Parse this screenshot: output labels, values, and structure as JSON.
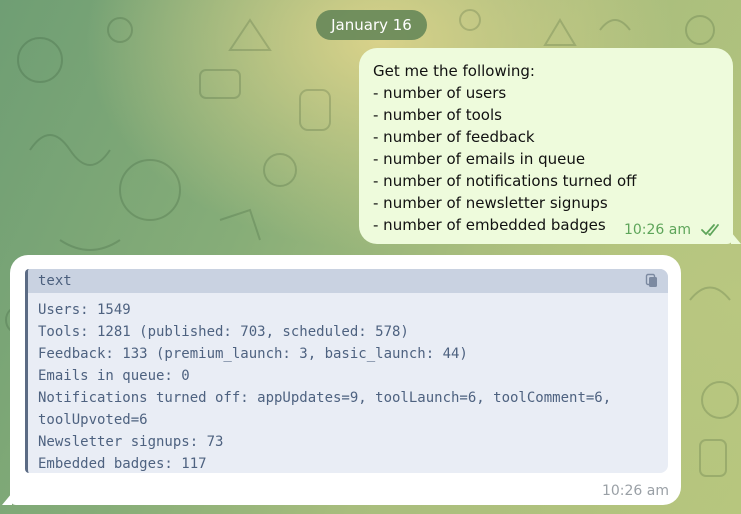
{
  "date_separator": "January 16",
  "outgoing_message": {
    "lines": [
      "Get me the following:",
      "- number of users",
      "- number of tools",
      "- number of feedback",
      "- number of emails in queue",
      "- number of notifications turned off",
      "- number of newsletter signups",
      "- number of embedded badges"
    ],
    "time": "10:26 am",
    "status_icon": "double-check-icon"
  },
  "incoming_message": {
    "code_language": "text",
    "copy_icon": "copy-icon",
    "code_lines": [
      "Users: 1549",
      "Tools: 1281 (published: 703, scheduled: 578)",
      "Feedback: 133 (premium_launch: 3, basic_launch: 44)",
      "Emails in queue: 0",
      "Notifications turned off: appUpdates=9, toolLaunch=6, toolComment=6,",
      "toolUpvoted=6",
      "Newsletter signups: 73",
      "Embedded badges: 117"
    ],
    "time": "10:26 am"
  },
  "colors": {
    "outgoing_bubble": "#eefbdc",
    "incoming_bubble": "#ffffff",
    "code_background": "#e9edf5",
    "code_text": "#4e6280",
    "check_color": "#5ea55a"
  }
}
